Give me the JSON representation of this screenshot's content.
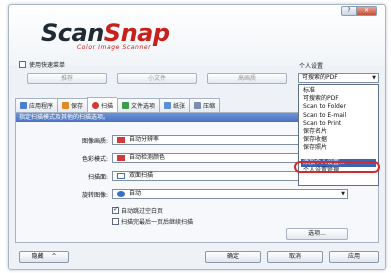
{
  "logo": {
    "scan": "Scan",
    "snap": "Snap",
    "tagline": "Color Image Scanner"
  },
  "title_buttons": {
    "help": "?",
    "close": "✕"
  },
  "quick_menu": {
    "label": "使用快速菜单",
    "checked": false
  },
  "presets": {
    "standard": "推荐",
    "small_file": "小文件",
    "high_quality": "高画质"
  },
  "profile": {
    "label": "个人设置",
    "selected": "可搜索的PDF",
    "options": [
      "标准",
      "可搜索的PDF",
      "Scan to Folder",
      "Scan to E-mail",
      "Scan to Print",
      "保存名片",
      "保存收据",
      "保存照片",
      "",
      "添加个人设置...",
      "个人设置管理..."
    ],
    "highlighted_index": 9
  },
  "tabs": [
    {
      "label": "应用程序",
      "icon": "application-icon",
      "color": "#4a7fd0",
      "active": false
    },
    {
      "label": "保存",
      "icon": "save-icon",
      "color": "#e08a2a",
      "active": false
    },
    {
      "label": "扫描",
      "icon": "scan-icon",
      "color": "#d23a3a",
      "active": true
    },
    {
      "label": "文件选项",
      "icon": "file-option-icon",
      "color": "#3f9a4a",
      "active": false
    },
    {
      "label": "纸张",
      "icon": "paper-icon",
      "color": "#5b8fd6",
      "active": false
    },
    {
      "label": "压缩",
      "icon": "compress-icon",
      "color": "#7a8fb0",
      "active": false
    }
  ],
  "panel": {
    "header": "指定扫描模式及其他的扫描选项。",
    "image_quality": {
      "label": "图像画质:",
      "value": "自动分辨率",
      "icon_color": "#d23a3a"
    },
    "color_mode": {
      "label": "色彩模式:",
      "value": "自动检测颜色",
      "icon_color": "#d23a3a"
    },
    "scanning_side": {
      "label": "扫描面:",
      "value": "双面扫描",
      "icon_color": "#4a6fb0"
    },
    "rotation": {
      "label": "旋转图像:",
      "value": "自动",
      "icon_color": "#3a6fc8"
    },
    "blank_page": {
      "label": "自动跳过空白页",
      "checked": true
    },
    "continue_scan": {
      "label": "扫描完最后一页后继续扫描",
      "checked": false
    },
    "option_button": "选项..."
  },
  "footer": {
    "hide": "隐藏",
    "hide_arrow": "^",
    "ok": "确定",
    "cancel": "取消",
    "apply": "应用"
  }
}
